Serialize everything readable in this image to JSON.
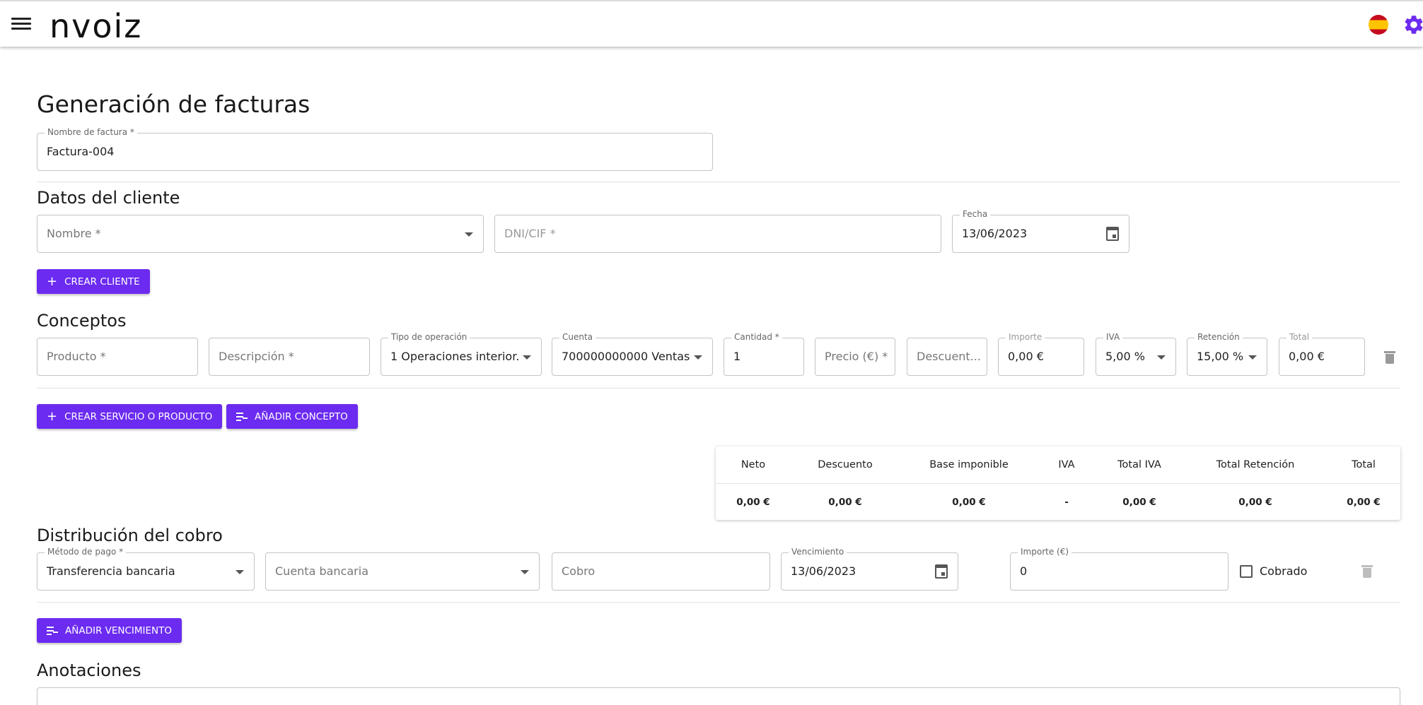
{
  "header": {
    "logo": "nvoiz"
  },
  "page_title": "Generación de facturas",
  "invoice_name": {
    "label": "Nombre de factura *",
    "value": "Factura-004"
  },
  "client": {
    "title": "Datos del cliente",
    "name_placeholder": "Nombre *",
    "dni_placeholder": "DNI/CIF *",
    "date_label": "Fecha",
    "date_value": "13/06/2023",
    "create_button": "CREAR CLIENTE"
  },
  "concepts": {
    "title": "Conceptos",
    "product_placeholder": "Producto *",
    "description_placeholder": "Descripción *",
    "operation_label": "Tipo de operación",
    "operation_value": "1 Operaciones interior...",
    "account_label": "Cuenta",
    "account_value": "700000000000 Ventas...",
    "quantity_label": "Cantidad *",
    "quantity_value": "1",
    "price_placeholder": "Precio (€) *",
    "discount_placeholder": "Descuent...",
    "amount_label": "Importe",
    "amount_value": "0,00 €",
    "iva_label": "IVA",
    "iva_value": "5,00 %",
    "retention_label": "Retención",
    "retention_value": "15,00 %",
    "total_label": "Total",
    "total_value": "0,00 €",
    "create_service_button": "CREAR SERVICIO O PRODUCTO",
    "add_concept_button": "AÑADIR CONCEPTO"
  },
  "totals": {
    "headers": [
      "Neto",
      "Descuento",
      "Base imponible",
      "IVA",
      "Total IVA",
      "Total Retención",
      "Total"
    ],
    "values": [
      "0,00 €",
      "0,00 €",
      "0,00 €",
      "-",
      "0,00 €",
      "0,00 €",
      "0,00 €"
    ]
  },
  "payment": {
    "title": "Distribución del cobro",
    "method_label": "Método de pago *",
    "method_value": "Transferencia bancaria",
    "bank_placeholder": "Cuenta bancaria",
    "charge_placeholder": "Cobro",
    "due_label": "Vencimiento",
    "due_value": "13/06/2023",
    "amount_label": "Importe (€)",
    "amount_value": "0",
    "collected_label": "Cobrado",
    "add_due_button": "AÑADIR VENCIMIENTO"
  },
  "notes": {
    "title": "Anotaciones"
  },
  "colors": {
    "accent": "#6c2bf0",
    "gear": "#6c2bf0"
  }
}
